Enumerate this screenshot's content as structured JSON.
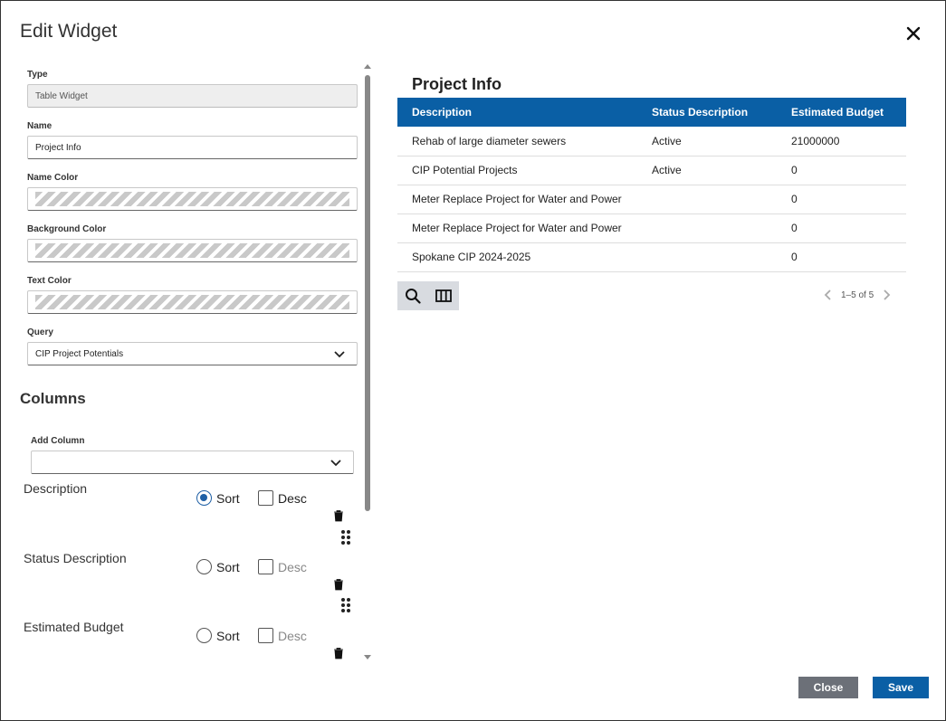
{
  "dialog": {
    "title": "Edit Widget"
  },
  "form": {
    "type_label": "Type",
    "type_value": "Table Widget",
    "name_label": "Name",
    "name_value": "Project Info",
    "name_color_label": "Name Color",
    "background_color_label": "Background Color",
    "text_color_label": "Text Color",
    "query_label": "Query",
    "query_value": "CIP Project Potentials"
  },
  "columns": {
    "title": "Columns",
    "add_column_label": "Add Column",
    "add_column_value": "",
    "items": [
      {
        "name": "Description",
        "sort_label": "Sort",
        "desc_label": "Desc",
        "sorted": true,
        "desc": false
      },
      {
        "name": "Status Description",
        "sort_label": "Sort",
        "desc_label": "Desc",
        "sorted": false,
        "desc": false
      },
      {
        "name": "Estimated Budget",
        "sort_label": "Sort",
        "desc_label": "Desc",
        "sorted": false,
        "desc": false
      }
    ]
  },
  "preview": {
    "title": "Project Info",
    "headers": [
      "Description",
      "Status Description",
      "Estimated Budget"
    ],
    "rows": [
      [
        "Rehab of large diameter sewers",
        "Active",
        "21000000"
      ],
      [
        "CIP Potential Projects",
        "Active",
        "0"
      ],
      [
        "Meter Replace Project for Water and Power",
        "",
        "0"
      ],
      [
        "Meter Replace Project for Water and Power",
        "",
        "0"
      ],
      [
        "Spokane CIP 2024-2025",
        "",
        "0"
      ]
    ],
    "pager_text": "1–5 of 5"
  },
  "footer": {
    "close_label": "Close",
    "save_label": "Save"
  },
  "colors": {
    "header_blue": "#0a5fa5",
    "close_gray": "#6c7078"
  }
}
